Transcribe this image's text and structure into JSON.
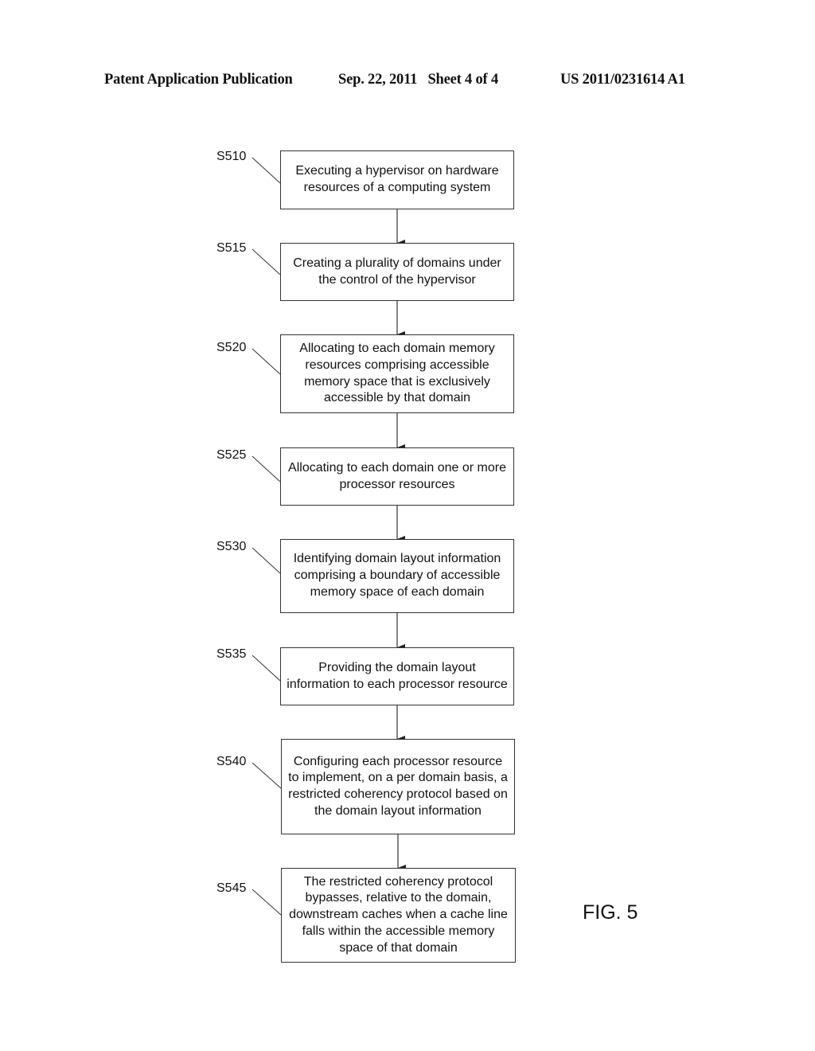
{
  "header": {
    "left": "Patent Application Publication",
    "middle": "Sep. 22, 2011   Sheet 4 of 4",
    "right": "US 2011/0231614 A1"
  },
  "figure_label": "FIG. 5",
  "steps": [
    {
      "id": "S510",
      "text": "Executing a hypervisor on hardware resources of a computing system"
    },
    {
      "id": "S515",
      "text": "Creating a plurality of domains under the control of the hypervisor"
    },
    {
      "id": "S520",
      "text": "Allocating to each domain memory resources comprising accessible memory space that is exclusively accessible by that domain"
    },
    {
      "id": "S525",
      "text": "Allocating to each domain one or more processor resources"
    },
    {
      "id": "S530",
      "text": "Identifying domain layout information comprising a boundary of accessible memory space of each domain"
    },
    {
      "id": "S535",
      "text": "Providing the domain layout information to each processor resource"
    },
    {
      "id": "S540",
      "text": "Configuring each processor resource to implement, on a per domain basis, a restricted coherency protocol based on the domain layout information"
    },
    {
      "id": "S545",
      "text": "The restricted coherency protocol bypasses, relative to the domain, downstream caches when a cache line falls within the accessible memory space of that domain"
    }
  ]
}
